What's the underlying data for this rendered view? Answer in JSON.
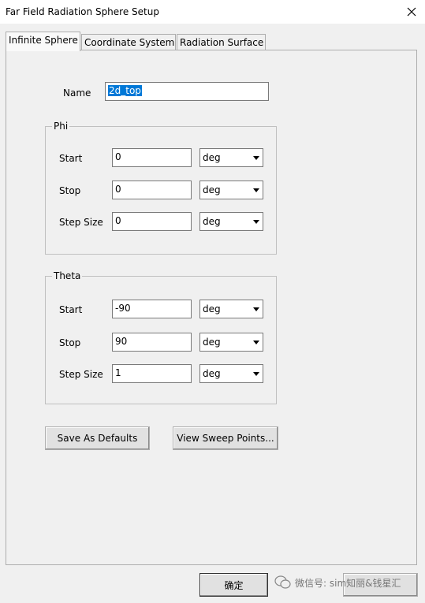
{
  "window": {
    "title": "Far Field Radiation Sphere Setup"
  },
  "tabs": [
    {
      "label": "Infinite Sphere",
      "active": true
    },
    {
      "label": "Coordinate System",
      "active": false
    },
    {
      "label": "Radiation Surface",
      "active": false
    }
  ],
  "name_field": {
    "label": "Name",
    "value": "2d_top"
  },
  "phi": {
    "title": "Phi",
    "rows": [
      {
        "label": "Start",
        "value": "0",
        "unit": "deg"
      },
      {
        "label": "Stop",
        "value": "0",
        "unit": "deg"
      },
      {
        "label": "Step Size",
        "value": "0",
        "unit": "deg"
      }
    ]
  },
  "theta": {
    "title": "Theta",
    "rows": [
      {
        "label": "Start",
        "value": "-90",
        "unit": "deg"
      },
      {
        "label": "Stop",
        "value": "90",
        "unit": "deg"
      },
      {
        "label": "Step Size",
        "value": "1",
        "unit": "deg"
      }
    ]
  },
  "buttons": {
    "save_defaults": "Save As Defaults",
    "view_sweep": "View Sweep Points...",
    "ok": "确定"
  },
  "watermark": {
    "text": "微信号: sim知丽&钱星汇"
  },
  "icons": {
    "close": "close-icon",
    "dropdown": "chevron-down-icon",
    "wechat": "wechat-icon"
  },
  "colors": {
    "selection": "#0078d7",
    "dialog_bg": "#f0f0f0"
  }
}
